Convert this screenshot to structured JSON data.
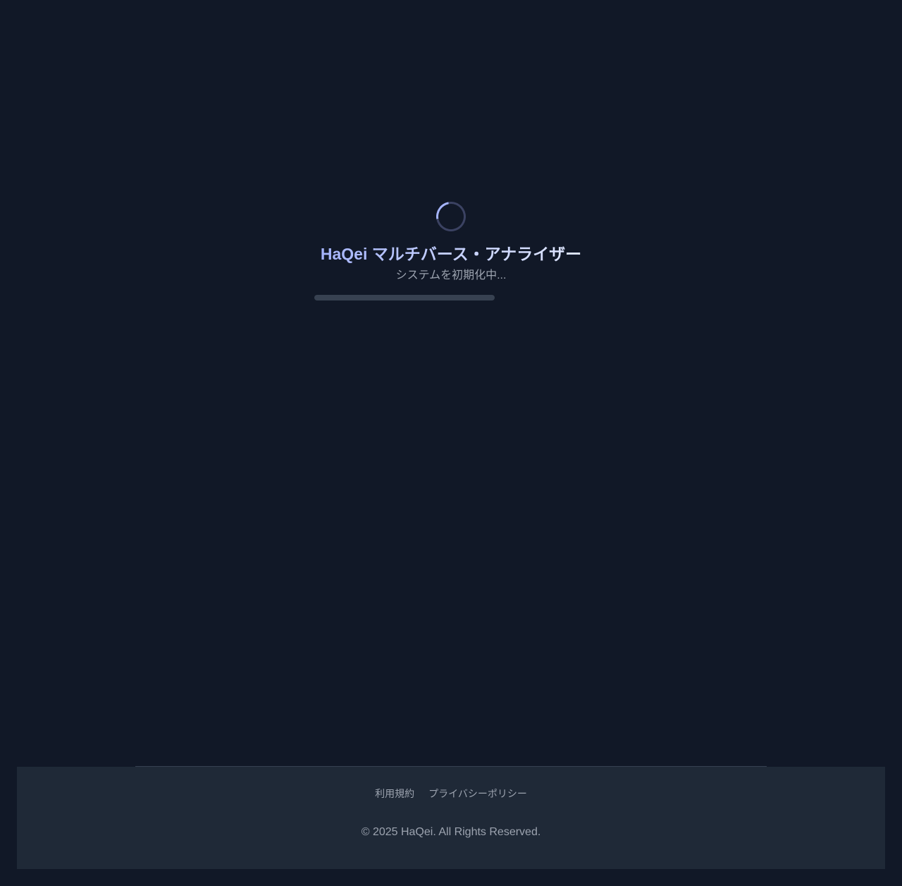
{
  "loading": {
    "spinner_icon": "loading-spinner-icon",
    "title": "HaQei マルチバース・アナライザー",
    "status": "システムを初期化中...",
    "progress": 0
  },
  "footer": {
    "links": [
      {
        "label": "利用規約"
      },
      {
        "label": "プライバシーポリシー"
      }
    ],
    "copyright": "© 2025 HaQei. All Rights Reserved."
  },
  "colors": {
    "background": "#111827",
    "footer_background": "#1f2937",
    "accent": "#a5b4fc",
    "muted_text": "#9ca3af",
    "track": "#374151"
  }
}
